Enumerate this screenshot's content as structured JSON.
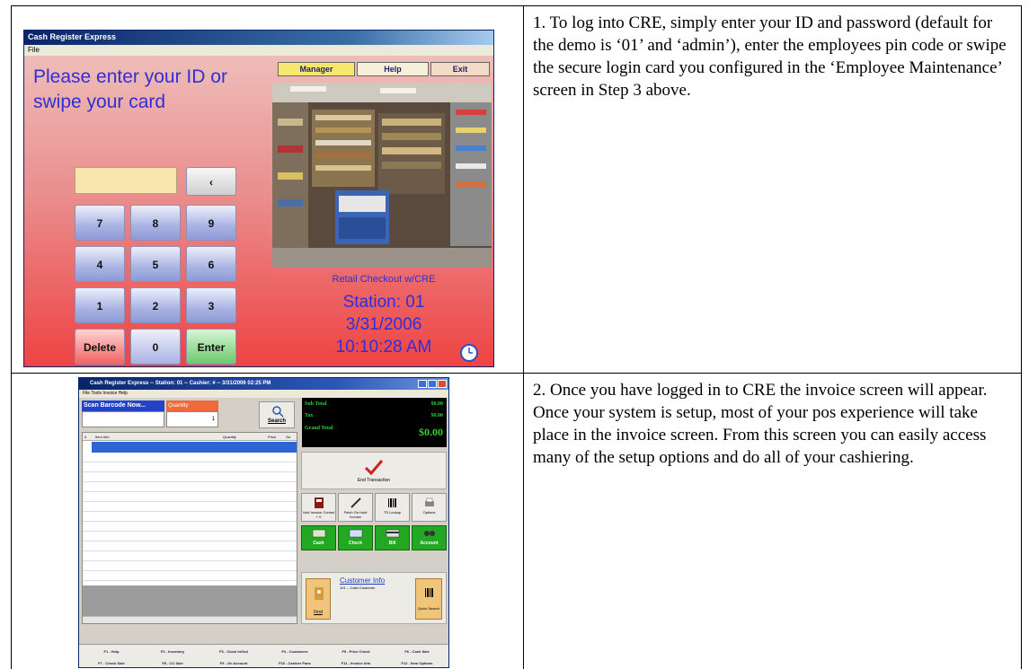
{
  "login_screen": {
    "window_title": "Cash Register Express",
    "menu": "File",
    "prompt": "Please enter your ID or swipe your card",
    "buttons": {
      "manager": "Manager",
      "help": "Help",
      "exit": "Exit"
    },
    "keypad": {
      "back": "‹",
      "k7": "7",
      "k8": "8",
      "k9": "9",
      "k4": "4",
      "k5": "5",
      "k6": "6",
      "k1": "1",
      "k2": "2",
      "k3": "3",
      "delete": "Delete",
      "k0": "0",
      "enter": "Enter"
    },
    "photo_caption": "Retail Checkout w/CRE",
    "station": "Station: 01",
    "date": "3/31/2006",
    "time": "10:10:28 AM",
    "icons": {
      "clock": "clock-icon"
    }
  },
  "invoice_screen": {
    "window_title": "Cash Register Express -- Station: 01 -- Cashier: # -- 3/31/2006 02:25 PM",
    "menu": "File  Tools  Invoice  Help",
    "scan_label": "Scan Barcode Now...",
    "quantity_label": "Quantity",
    "quantity_value": "1",
    "search_label": "Search",
    "totals": {
      "sub_total_label": "Sub Total",
      "sub_total_value": "$0.00",
      "tax_label": "Tax",
      "tax_value": "$0.00",
      "grand_total_label": "Grand Total",
      "grand_total_value": "$0.00"
    },
    "grid_headers": {
      "num": "#",
      "item_info": "Item Info",
      "quantity": "Quantity",
      "price": "Price",
      "sa": "Sa"
    },
    "end_transaction": "End Transaction",
    "function_buttons": {
      "void": "Void Invoice Control + V",
      "fetch": "Fetch On Hold Invoice",
      "ts_lookup": "TS Lookup",
      "options": "Options"
    },
    "payment_buttons": {
      "cash": "Cash",
      "check": "Check",
      "bill": "Bill",
      "account": "Account"
    },
    "customer": {
      "title": "Customer Info",
      "name": "101 -- Cash Customer",
      "find": "Find",
      "quick_search": "Quick Search"
    },
    "fkeys_row1": [
      "F1 - Help",
      "F2 - Inventory",
      "F3 - Clock In/Out",
      "F4 - Customers",
      "F5 - Price Check",
      "F6 - Cash Sale"
    ],
    "fkeys_row2": [
      "F7 - Check Sale",
      "F8 - CC Sale",
      "F9 - On Account",
      "F10 - Cashier Fans",
      "F11 - Invoice Info",
      "F12 - Item Options"
    ]
  },
  "instructions": {
    "step1": "1.  To log into CRE, simply enter your ID and password (default for the demo is ‘01’ and ‘admin’), enter the employees pin code or swipe the secure login card you configured in the ‘Employee Maintenance’ screen in Step 3 above.",
    "step2": "2.  Once you have logged in to CRE the invoice screen will appear.  Once your system is setup, most of your pos experience will take place in the invoice screen.  From this screen you can easily access many of the setup options and do all of your cashiering."
  }
}
